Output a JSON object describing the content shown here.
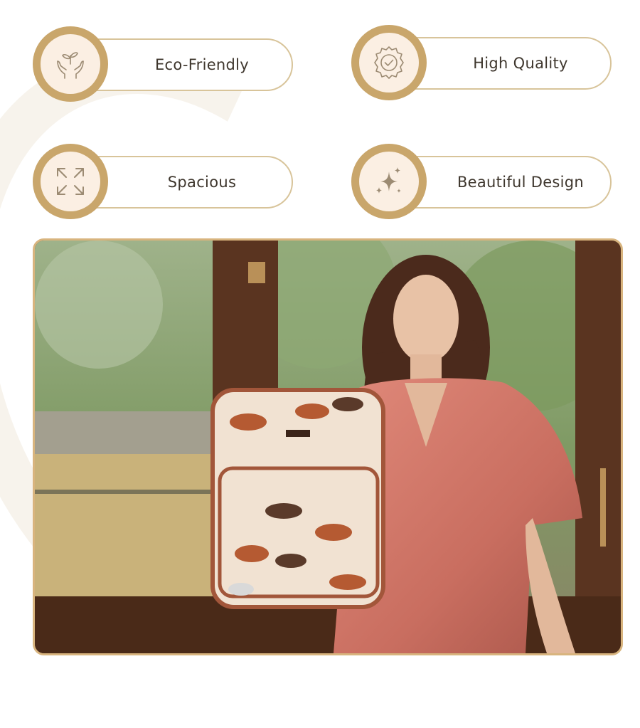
{
  "features": [
    {
      "label": "Eco-Friendly",
      "icon": "hands-sprout-icon"
    },
    {
      "label": "High Quality",
      "icon": "quality-seal-check-icon"
    },
    {
      "label": "Spacious",
      "icon": "expand-arrows-icon"
    },
    {
      "label": "Beautiful Design",
      "icon": "sparkles-icon"
    }
  ],
  "colors": {
    "badge_ring": "#c9a66b",
    "badge_fill": "#fbefe3",
    "pill_border": "#d8c49a",
    "icon_stroke": "#9c8b73",
    "photo_frame": "#d8b47e"
  },
  "photo": {
    "subject": "woman-with-horse-print-backpack-photo"
  }
}
